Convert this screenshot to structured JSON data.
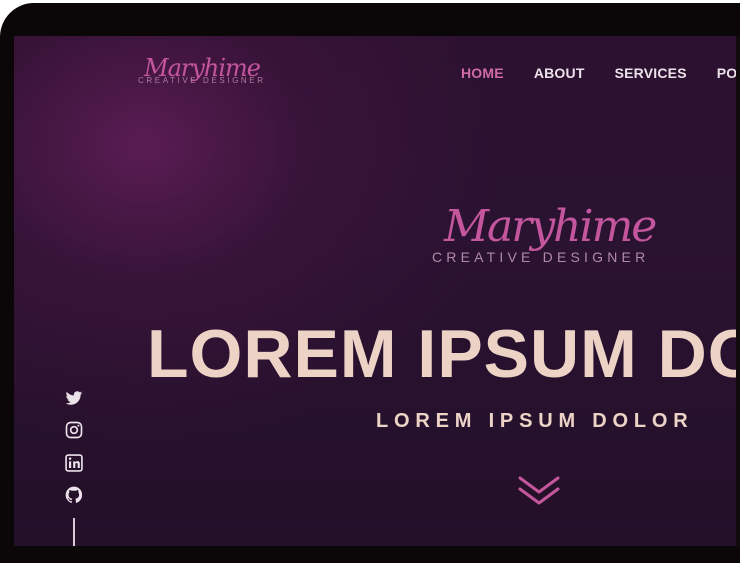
{
  "brand": {
    "script": "Maryhime",
    "tagline": "CREATIVE DESIGNER"
  },
  "nav": {
    "items": [
      {
        "label": "HOME",
        "active": true
      },
      {
        "label": "ABOUT",
        "active": false
      },
      {
        "label": "SERVICES",
        "active": false
      },
      {
        "label": "PO",
        "active": false
      }
    ]
  },
  "hero": {
    "title": "LOREM IPSUM DO",
    "subtitle": "LOREM IPSUM DOLOR",
    "scroll_icon": "double-chevron-down-icon"
  },
  "social": {
    "icons": [
      "twitter-icon",
      "instagram-icon",
      "linkedin-icon",
      "github-icon"
    ]
  },
  "colors": {
    "accent": "#d06aa8",
    "hero_text": "#ecd3c6",
    "background": "#2a1231"
  }
}
